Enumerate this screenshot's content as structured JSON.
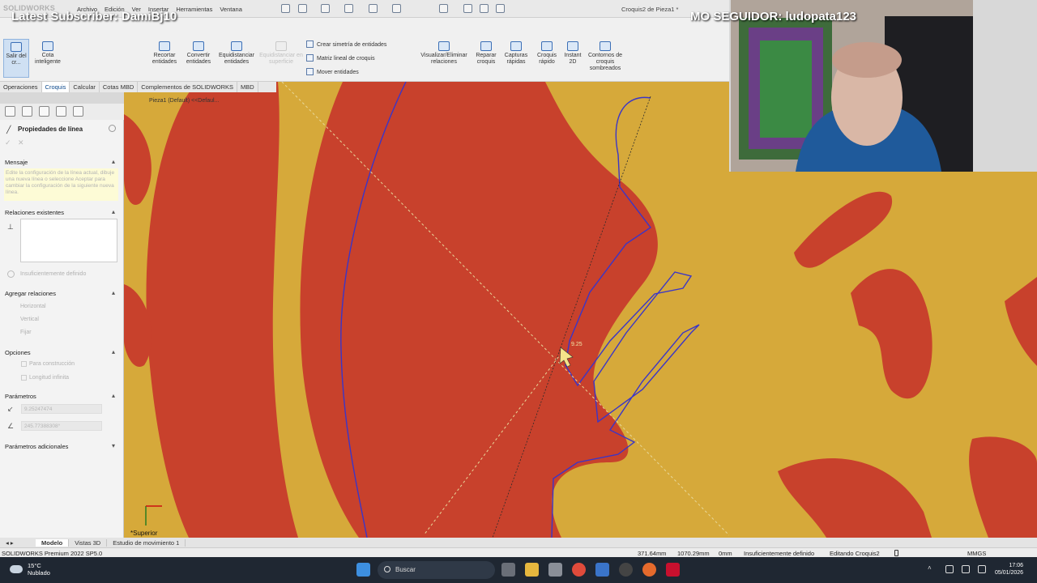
{
  "app": {
    "brand": "SOLIDWORKS",
    "document_title": "Croquis2 de Pieza1 *"
  },
  "menu": [
    "Archivo",
    "Edición",
    "Ver",
    "Insertar",
    "Herramientas",
    "Ventana"
  ],
  "ribbon": {
    "exit_sketch": "Salir del cr...",
    "smart_dimension": "Cota inteligente",
    "trim": "Recortar entidades",
    "convert": "Convertir entidades",
    "offset": "Equidistanciar entidades",
    "offset_surface": "Equidistanciar en superficie",
    "mirror": "Crear simetría de entidades",
    "linear_pattern": "Matriz lineal de croquis",
    "move": "Mover entidades",
    "display_relations": "Visualizar/Eliminar relaciones",
    "repair": "Reparar croquis",
    "quick_snaps": "Capturas rápidas",
    "rapid_sketch": "Croquis rápido",
    "instant2d": "Instant 2D",
    "shaded_contours": "Contornos de croquis sombreados"
  },
  "tabs": [
    "Operaciones",
    "Croquis",
    "Calcular",
    "Cotas MBD",
    "Complementos de SOLIDWORKS",
    "MBD"
  ],
  "active_tab": "Croquis",
  "property_manager": {
    "title": "Propiedades de línea",
    "message_header": "Mensaje",
    "message_text": "Edite la configuración de la línea actual, dibuje una nueva línea o seleccione Aceptar para cambiar la configuración de la siguiente nueva línea.",
    "existing_relations": "Relaciones existentes",
    "status": "Insuficientemente definido",
    "add_relations": "Agregar relaciones",
    "relations": [
      "Horizontal",
      "Vertical",
      "Fijar"
    ],
    "options": "Opciones",
    "option_items": [
      "Para construcción",
      "Longitud infinita"
    ],
    "parameters": "Parámetros",
    "length_value": "9.25247474",
    "angle_value": "245.77388308°",
    "additional_parameters": "Parámetros adicionales"
  },
  "graphics": {
    "tree_root": "Pieza1 (Default) <<Defaul...",
    "view_label": "*Superior",
    "dimension_readout": "9.25",
    "sketch_color": "#3a35c8",
    "fill_red": "#c8412c",
    "fill_yellow": "#d6a93a"
  },
  "overlay": {
    "latest_subscriber": "Latest Subscriber: DamiBj10",
    "last_follower": "MO SEGUIDOR: ludopata123"
  },
  "model_tabs": [
    "Modelo",
    "Vistas 3D",
    "Estudio de movimiento 1"
  ],
  "status_bar": {
    "product": "SOLIDWORKS Premium 2022 SP5.0",
    "x": "371.64mm",
    "y": "1070.29mm",
    "z": "0mm",
    "definition": "Insuficientemente definido",
    "editing": "Editando Croquis2",
    "units": "MMGS"
  },
  "taskbar": {
    "temperature": "15°C",
    "weather": "Nublado",
    "search_placeholder": "Buscar",
    "time": "17:06",
    "date": "05/01/2026"
  }
}
